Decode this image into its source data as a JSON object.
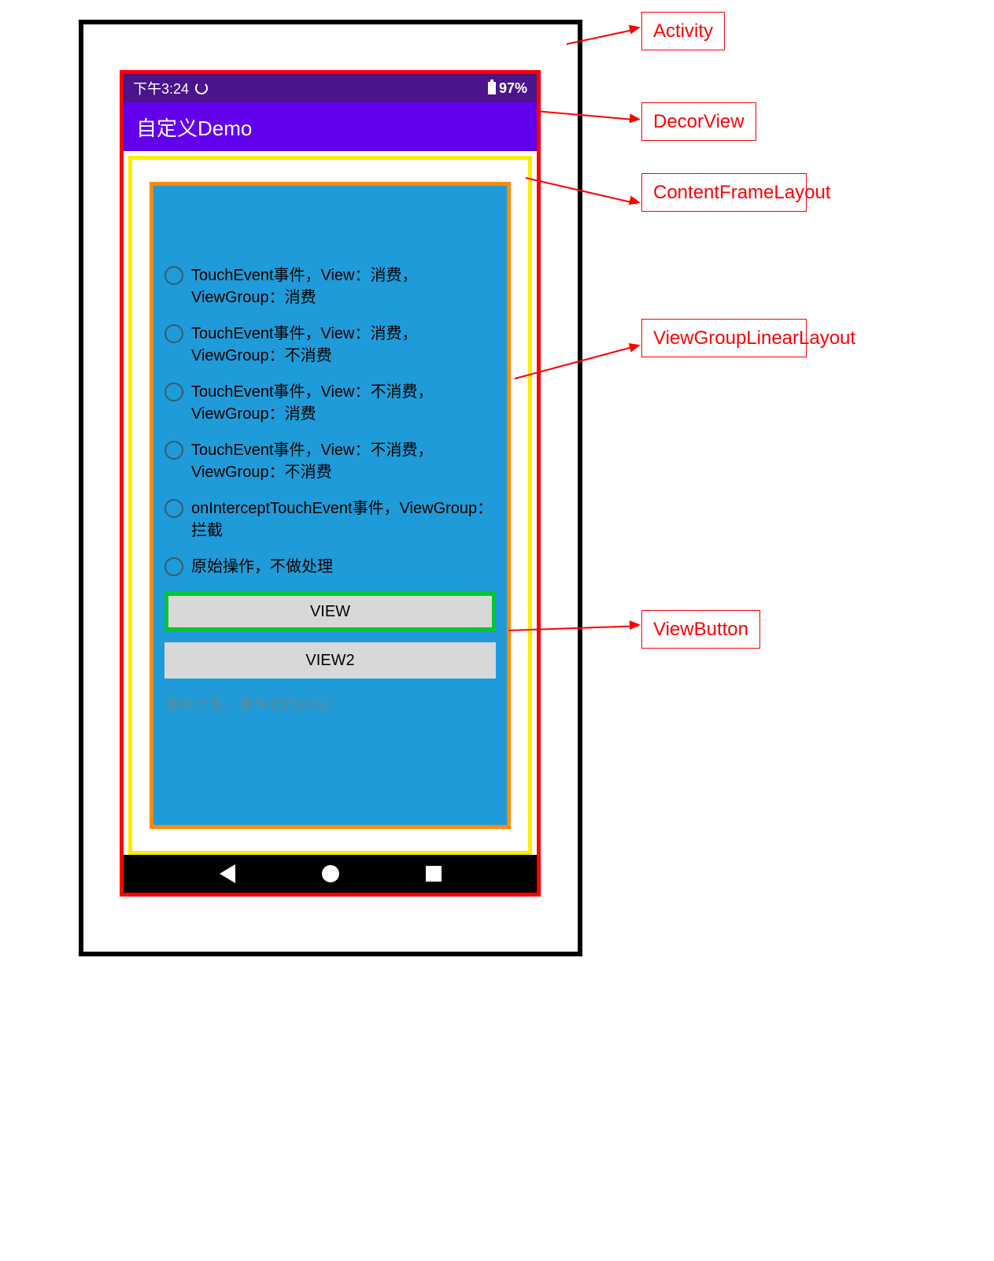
{
  "statusBar": {
    "time": "下午3:24",
    "battery": "97%"
  },
  "appBar": {
    "title": "自定义Demo"
  },
  "radios": [
    "TouchEvent事件，View：消费，ViewGroup：消费",
    "TouchEvent事件，View：消费，ViewGroup：不消费",
    "TouchEvent事件，View：不消费，ViewGroup：消费",
    "TouchEvent事件，View：不消费，ViewGroup：不消费",
    "onInterceptTouchEvent事件，ViewGroup：拦截",
    "原始操作，不做处理"
  ],
  "buttons": {
    "view": "VIEW",
    "view2": "VIEW2"
  },
  "footer": "事件分发，事件调用过程：",
  "annotations": {
    "activity": "Activity",
    "decorView": "DecorView",
    "contentFrame": "ContentFrameLayout",
    "viewGroup": "ViewGroupLinearLayout",
    "viewButton": "ViewButton"
  }
}
